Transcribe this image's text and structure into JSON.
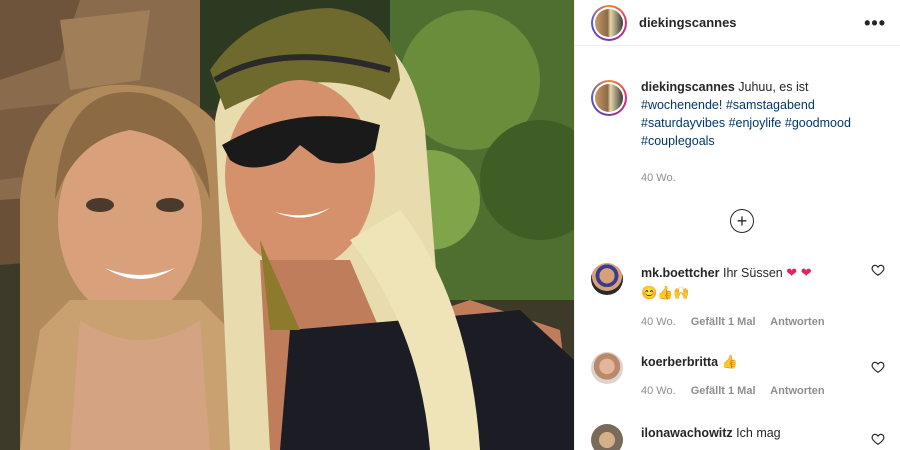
{
  "post": {
    "username": "diekingscannes",
    "more_icon": "more-options-icon",
    "caption": {
      "username": "diekingscannes",
      "text": "Juhuu, es ist",
      "hashtags": [
        "#wochenende!",
        "#samstagabend",
        "#saturdayvibes",
        "#enjoylife",
        "#goodmood",
        "#couplegoals"
      ],
      "time": "40 Wo."
    },
    "load_more_icon": "plus-circle-icon"
  },
  "comments": [
    {
      "username": "mk.boettcher",
      "text": "Ihr Süssen",
      "emojis_line1": "❤ ❤",
      "emojis_line2": "😊👍🙌",
      "time": "40 Wo.",
      "likes": "Gefällt 1 Mal",
      "reply": "Antworten"
    },
    {
      "username": "koerberbritta",
      "text": "",
      "emojis_line1": "👍",
      "time": "40 Wo.",
      "likes": "Gefällt 1 Mal",
      "reply": "Antworten"
    },
    {
      "username": "ilonawachowitz",
      "text": "Ich mag"
    }
  ],
  "colors": {
    "hashtag": "#00376b",
    "muted": "#8e8e8e",
    "heart_emoji": "#e0245e"
  }
}
